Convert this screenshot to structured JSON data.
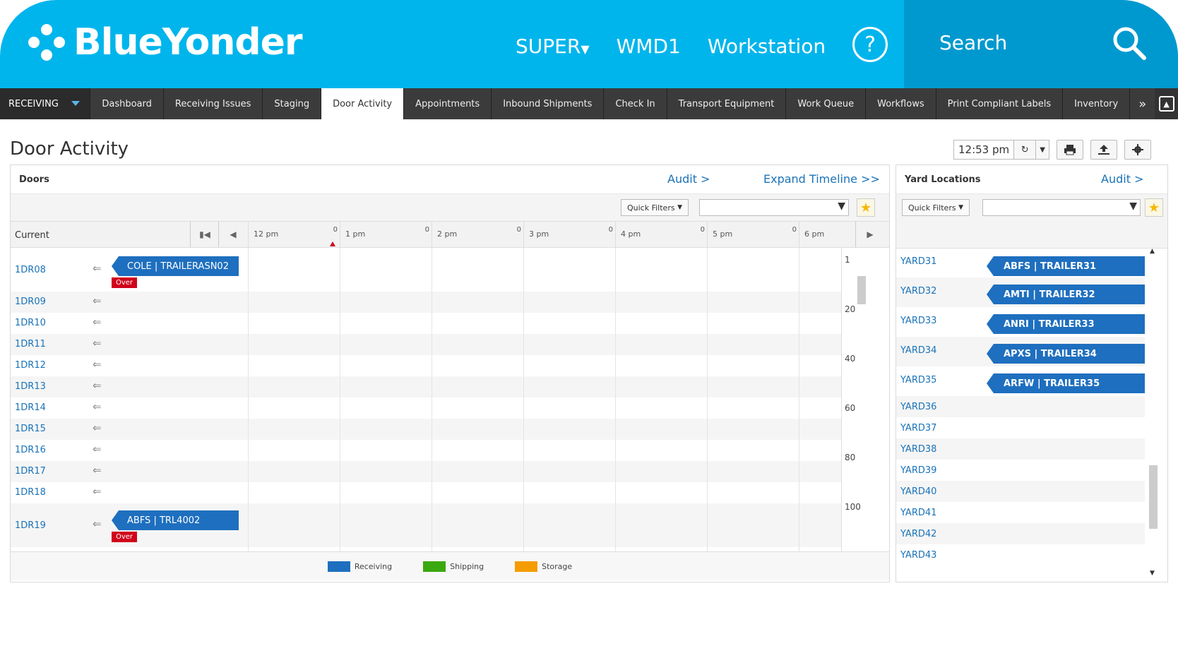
{
  "header": {
    "brand": "BlueYonder",
    "user_menu": "SUPER",
    "warehouse": "WMD1",
    "workstation": "Workstation",
    "help_glyph": "?",
    "search_label": "Search",
    "bg_color": "#00b5ec"
  },
  "menu": {
    "module": "RECEIVING",
    "tabs": [
      {
        "label": "Dashboard"
      },
      {
        "label": "Receiving Issues"
      },
      {
        "label": "Staging"
      },
      {
        "label": "Door Activity"
      },
      {
        "label": "Appointments"
      },
      {
        "label": "Inbound Shipments"
      },
      {
        "label": "Check In"
      },
      {
        "label": "Transport Equipment"
      },
      {
        "label": "Work Queue"
      },
      {
        "label": "Workflows"
      },
      {
        "label": "Print Compliant Labels"
      },
      {
        "label": "Inventory"
      }
    ],
    "more_glyph": "»",
    "active_tab": "Door Activity"
  },
  "page": {
    "title": "Door Activity",
    "time": "12:53 pm"
  },
  "doors": {
    "title": "Doors",
    "audit": "Audit >",
    "expand": "Expand Timeline >>",
    "quick_filters": "Quick Filters",
    "current_label": "Current",
    "hours": [
      "12 pm",
      "1 pm",
      "2 pm",
      "3 pm",
      "4 pm",
      "5 pm",
      "6 pm"
    ],
    "hour_marker": "0",
    "rows": [
      {
        "name": "1DR08",
        "chip": "COLE | TRAILERASN02",
        "flag": "Over"
      },
      {
        "name": "1DR09"
      },
      {
        "name": "1DR10"
      },
      {
        "name": "1DR11"
      },
      {
        "name": "1DR12"
      },
      {
        "name": "1DR13"
      },
      {
        "name": "1DR14"
      },
      {
        "name": "1DR15"
      },
      {
        "name": "1DR16"
      },
      {
        "name": "1DR17"
      },
      {
        "name": "1DR18"
      },
      {
        "name": "1DR19",
        "chip": "ABFS | TRL4002",
        "flag": "Over"
      }
    ],
    "zoom_labels": [
      "1",
      "20",
      "40",
      "60",
      "80",
      "100"
    ],
    "legend": [
      {
        "label": "Receiving",
        "color": "#1e6fbf"
      },
      {
        "label": "Shipping",
        "color": "#3aa80f"
      },
      {
        "label": "Storage",
        "color": "#f59c00"
      }
    ]
  },
  "yard": {
    "title": "Yard Locations",
    "audit": "Audit >",
    "quick_filters": "Quick Filters",
    "rows": [
      {
        "name": "YARD31",
        "chip": "ABFS | TRAILER31"
      },
      {
        "name": "YARD32",
        "chip": "AMTI | TRAILER32"
      },
      {
        "name": "YARD33",
        "chip": "ANRI | TRAILER33"
      },
      {
        "name": "YARD34",
        "chip": "APXS | TRAILER34"
      },
      {
        "name": "YARD35",
        "chip": "ARFW | TRAILER35"
      },
      {
        "name": "YARD36"
      },
      {
        "name": "YARD37"
      },
      {
        "name": "YARD38"
      },
      {
        "name": "YARD39"
      },
      {
        "name": "YARD40"
      },
      {
        "name": "YARD41"
      },
      {
        "name": "YARD42"
      },
      {
        "name": "YARD43"
      }
    ]
  }
}
